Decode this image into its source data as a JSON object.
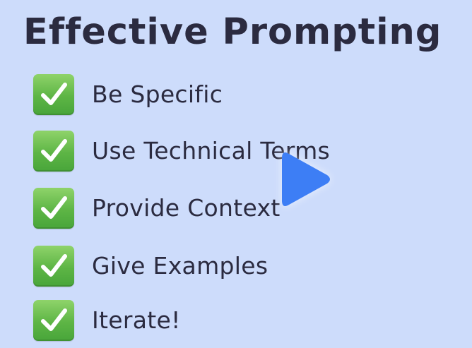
{
  "slide": {
    "title": "Effective Prompting",
    "items": [
      {
        "icon": "check-mark-icon",
        "label": "Be Specific"
      },
      {
        "icon": "check-mark-icon",
        "label": "Use Technical Terms"
      },
      {
        "icon": "check-mark-icon",
        "label": "Provide Context"
      },
      {
        "icon": "check-mark-icon",
        "label": "Give Examples"
      },
      {
        "icon": "check-mark-icon",
        "label": "Iterate!"
      }
    ]
  },
  "player": {
    "play_icon": "play-icon"
  },
  "colors": {
    "background": "#cddcfb",
    "text": "#2b2b40",
    "check_green": "#5db545",
    "play_blue": "#3d7ef5"
  }
}
